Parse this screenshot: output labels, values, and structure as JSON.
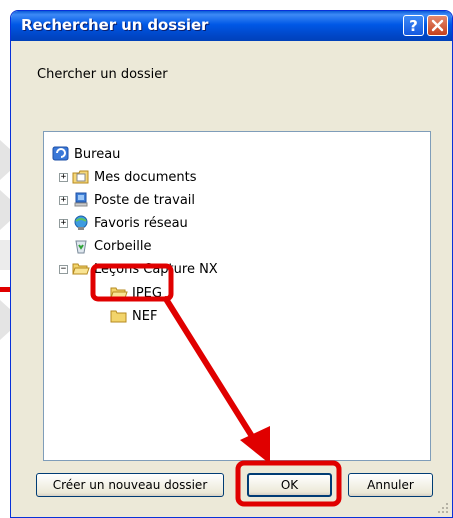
{
  "dialog": {
    "title": "Rechercher un dossier",
    "help_label": "?",
    "instruction": "Chercher un dossier"
  },
  "tree": {
    "root": "Bureau",
    "items": [
      {
        "label": "Mes documents",
        "icon": "my-documents-icon",
        "expander": "+"
      },
      {
        "label": "Poste de travail",
        "icon": "computer-icon",
        "expander": "+"
      },
      {
        "label": "Favoris réseau",
        "icon": "network-icon",
        "expander": "+"
      },
      {
        "label": "Corbeille",
        "icon": "recycle-bin-icon",
        "expander": ""
      },
      {
        "label": "Leçons Capture NX",
        "icon": "folder-open-icon",
        "expander": "−"
      }
    ],
    "subfolders": [
      {
        "label": "JPEG",
        "icon": "folder-open-icon",
        "selected": true
      },
      {
        "label": "NEF",
        "icon": "folder-icon",
        "selected": false
      }
    ]
  },
  "buttons": {
    "new_folder": "Créer un nouveau dossier",
    "ok": "OK",
    "cancel": "Annuler"
  },
  "colors": {
    "titlebar": "#0054e3",
    "highlight": "#e00000",
    "selection": "#316ac5"
  }
}
